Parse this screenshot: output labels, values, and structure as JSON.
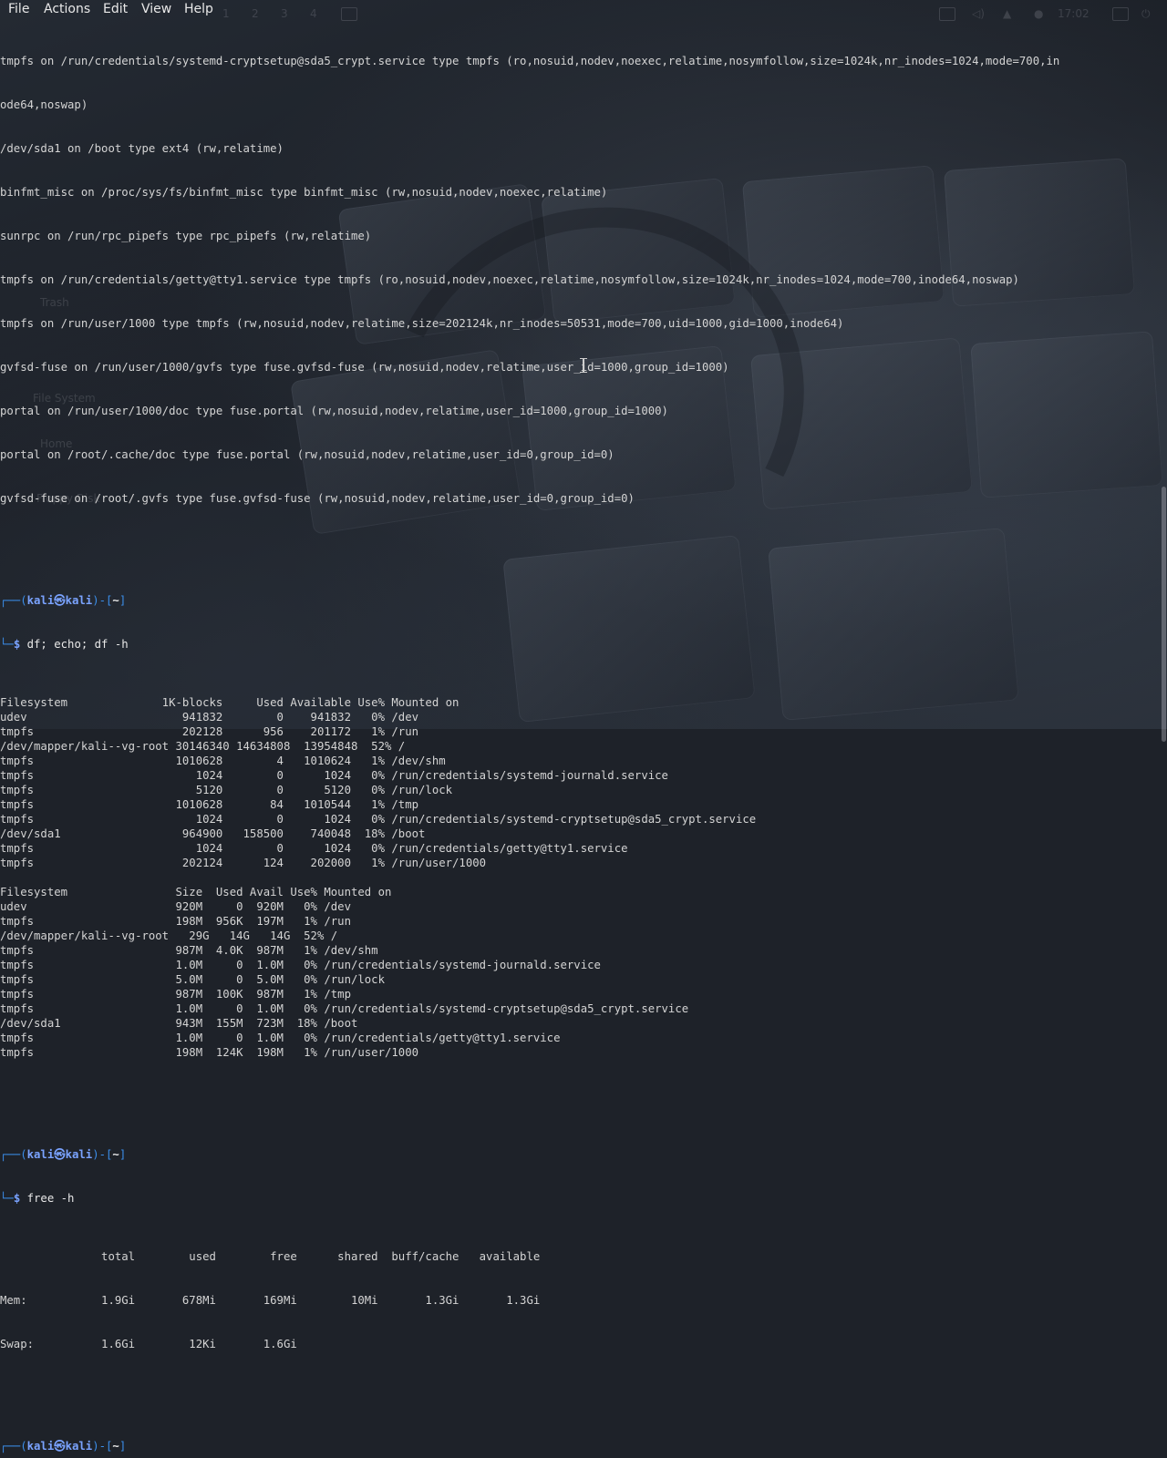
{
  "menubar": {
    "items": [
      "File",
      "Actions",
      "Edit",
      "View",
      "Help"
    ]
  },
  "panel": {
    "workspaces": [
      "1",
      "2",
      "3",
      "4"
    ],
    "clock": "17:02"
  },
  "desktop_icons": [
    "Trash",
    "File System",
    "Home",
    "Floppy Disk"
  ],
  "prompt": {
    "user": "kali",
    "at": "㉿",
    "host": "kali",
    "dir": "~"
  },
  "terminal": {
    "mount_tail": [
      "tmpfs on /run/credentials/systemd-cryptsetup@sda5_crypt.service type tmpfs (ro,nosuid,nodev,noexec,relatime,nosymfollow,size=1024k,nr_inodes=1024,mode=700,in",
      "ode64,noswap)",
      "/dev/sda1 on /boot type ext4 (rw,relatime)",
      "binfmt_misc on /proc/sys/fs/binfmt_misc type binfmt_misc (rw,nosuid,nodev,noexec,relatime)",
      "sunrpc on /run/rpc_pipefs type rpc_pipefs (rw,relatime)",
      "tmpfs on /run/credentials/getty@tty1.service type tmpfs (ro,nosuid,nodev,noexec,relatime,nosymfollow,size=1024k,nr_inodes=1024,mode=700,inode64,noswap)",
      "tmpfs on /run/user/1000 type tmpfs (rw,nosuid,nodev,relatime,size=202124k,nr_inodes=50531,mode=700,uid=1000,gid=1000,inode64)",
      "gvfsd-fuse on /run/user/1000/gvfs type fuse.gvfsd-fuse (rw,nosuid,nodev,relatime,user_id=1000,group_id=1000)",
      "portal on /run/user/1000/doc type fuse.portal (rw,nosuid,nodev,relatime,user_id=1000,group_id=1000)",
      "portal on /root/.cache/doc type fuse.portal (rw,nosuid,nodev,relatime,user_id=0,group_id=0)",
      "gvfsd-fuse on /root/.gvfs type fuse.gvfsd-fuse (rw,nosuid,nodev,relatime,user_id=0,group_id=0)"
    ],
    "cmd1": "df; echo; df -h",
    "df_output": [
      "Filesystem              1K-blocks     Used Available Use% Mounted on",
      "udev                       941832        0    941832   0% /dev",
      "tmpfs                      202128      956    201172   1% /run",
      "/dev/mapper/kali--vg-root 30146340 14634808  13954848  52% /",
      "tmpfs                     1010628        4   1010624   1% /dev/shm",
      "tmpfs                        1024        0      1024   0% /run/credentials/systemd-journald.service",
      "tmpfs                        5120        0      5120   0% /run/lock",
      "tmpfs                     1010628       84   1010544   1% /tmp",
      "tmpfs                        1024        0      1024   0% /run/credentials/systemd-cryptsetup@sda5_crypt.service",
      "/dev/sda1                  964900   158500    740048  18% /boot",
      "tmpfs                        1024        0      1024   0% /run/credentials/getty@tty1.service",
      "tmpfs                      202124      124    202000   1% /run/user/1000",
      "",
      "Filesystem                Size  Used Avail Use% Mounted on",
      "udev                      920M     0  920M   0% /dev",
      "tmpfs                     198M  956K  197M   1% /run",
      "/dev/mapper/kali--vg-root   29G   14G   14G  52% /",
      "tmpfs                     987M  4.0K  987M   1% /dev/shm",
      "tmpfs                     1.0M     0  1.0M   0% /run/credentials/systemd-journald.service",
      "tmpfs                     5.0M     0  5.0M   0% /run/lock",
      "tmpfs                     987M  100K  987M   1% /tmp",
      "tmpfs                     1.0M     0  1.0M   0% /run/credentials/systemd-cryptsetup@sda5_crypt.service",
      "/dev/sda1                 943M  155M  723M  18% /boot",
      "tmpfs                     1.0M     0  1.0M   0% /run/credentials/getty@tty1.service",
      "tmpfs                     198M  124K  198M   1% /run/user/1000"
    ],
    "cmd2": "free -h",
    "free_output": [
      "               total        used        free      shared  buff/cache   available",
      "Mem:           1.9Gi       678Mi       169Mi        10Mi       1.3Gi       1.3Gi",
      "Swap:          1.6Gi        12Ki       1.6Gi"
    ]
  },
  "colors": {
    "background": "#1e2229",
    "text": "#d4d4d4",
    "prompt_frame": "#3b8eea",
    "prompt_host": "#7aa3ff"
  }
}
